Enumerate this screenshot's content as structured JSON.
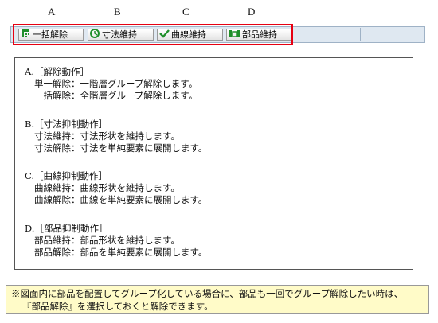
{
  "column_labels": [
    "A",
    "B",
    "C",
    "D"
  ],
  "toolbar": {
    "buttons": [
      {
        "label": "一括解除",
        "icon": "ungroup-all-icon"
      },
      {
        "label": "寸法維持",
        "icon": "dimension-keep-icon"
      },
      {
        "label": "曲線維持",
        "icon": "curve-keep-icon"
      },
      {
        "label": "部品維持",
        "icon": "part-keep-icon"
      }
    ]
  },
  "description": {
    "sections": [
      {
        "heading": "A.［解除動作］",
        "lines": [
          "単一解除：一階層グループ解除します。",
          "一括解除：全階層グループ解除します。"
        ]
      },
      {
        "heading": "B.［寸法抑制動作］",
        "lines": [
          "寸法維持：寸法形状を維持します。",
          "寸法解除：寸法を単純要素に展開します。"
        ]
      },
      {
        "heading": "C.［曲線抑制動作］",
        "lines": [
          "曲線維持：曲線形状を維持します。",
          "曲線解除：曲線を単純要素に展開します。"
        ]
      },
      {
        "heading": "D.［部品抑制動作］",
        "lines": [
          "部品維持：部品形状を維持します。",
          "部品解除：部品を単純要素に展開します。"
        ]
      }
    ]
  },
  "note": {
    "line1": "※図面内に部品を配置してグループ化している場合に、部品も一回でグループ解除したい時は、",
    "line2": "『部品解除』を選択しておくと解除できます。"
  },
  "colors": {
    "highlight": "#e60012",
    "toolbar_bg": "#dfe8f1",
    "note_bg": "#fffbc8",
    "icon_green": "#1f8f2a"
  }
}
